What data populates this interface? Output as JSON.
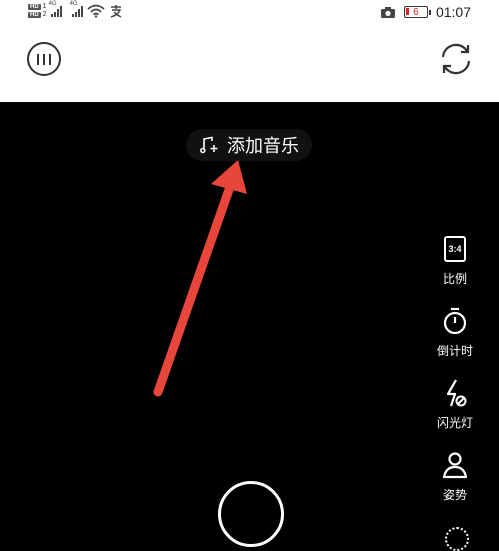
{
  "status_bar": {
    "sim1": "HD",
    "sim1_num": "1",
    "sim2": "HD",
    "sim2_num": "2",
    "net1": "4G",
    "net2": "4G",
    "battery_level": "6",
    "time": "01:07",
    "icons": [
      "wifi-icon",
      "alipay-icon",
      "camera-icon"
    ]
  },
  "top_bar": {
    "icons": [
      "menu-icon",
      "flip-camera-icon"
    ]
  },
  "camera": {
    "music_label": "添加音乐",
    "tools": [
      {
        "icon": "ratio-icon",
        "icon_text": "3:4",
        "label": "比例"
      },
      {
        "icon": "timer-icon",
        "label": "倒计时"
      },
      {
        "icon": "flash-off-icon",
        "label": "闪光灯"
      },
      {
        "icon": "pose-icon",
        "label": "姿势"
      }
    ],
    "colors": {
      "annotation_arrow": "#e8463a",
      "battery_low": "#e02020"
    }
  }
}
